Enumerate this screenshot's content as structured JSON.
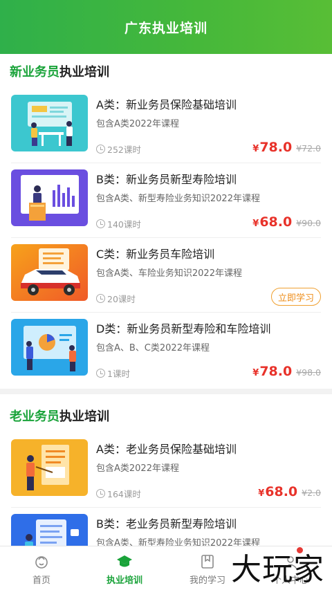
{
  "header": {
    "title": "广东执业培训"
  },
  "sections": [
    {
      "title_highlight": "新业务员",
      "title_rest": "执业培训",
      "courses": [
        {
          "title": "A类：新业务员保险基础培训",
          "desc": "包含A类2022年课程",
          "hours": "252课时",
          "price_symbol": "¥",
          "price": "78.0",
          "original": "¥72.0",
          "thumb": "meeting-illustration"
        },
        {
          "title": "B类：新业务员新型寿险培训",
          "desc": "包含A类、新型寿险业务知识2022年课程",
          "hours": "140课时",
          "price_symbol": "¥",
          "price": "68.0",
          "original": "¥90.0",
          "thumb": "presentation-illustration"
        },
        {
          "title": "C类：新业务员车险培训",
          "desc": "包含A类、车险业务知识2022年课程",
          "hours": "20课时",
          "button": "立即学习",
          "thumb": "car-illustration"
        },
        {
          "title": "D类：新业务员新型寿险和车险培训",
          "desc": "包含A、B、C类2022年课程",
          "hours": "1课时",
          "price_symbol": "¥",
          "price": "78.0",
          "original": "¥98.0",
          "thumb": "analytics-illustration"
        }
      ]
    },
    {
      "title_highlight": "老业务员",
      "title_rest": "执业培训",
      "courses": [
        {
          "title": "A类：老业务员保险基础培训",
          "desc": "包含A类2022年课程",
          "hours": "164课时",
          "price_symbol": "¥",
          "price": "68.0",
          "original": "¥2.0",
          "thumb": "teacher-illustration"
        },
        {
          "title": "B类：老业务员新型寿险培训",
          "desc": "包含A类、新型寿险业务知识2022年课程",
          "thumb": "document-illustration"
        }
      ]
    }
  ],
  "tabbar": {
    "items": [
      {
        "label": "首页",
        "icon": "home-icon"
      },
      {
        "label": "执业培训",
        "icon": "graduation-cap-icon",
        "active": true
      },
      {
        "label": "我的学习",
        "icon": "bookmark-book-icon"
      },
      {
        "label": "个人中心",
        "icon": "person-icon"
      }
    ]
  },
  "watermark": "大玩家",
  "colors": {
    "brand_green": "#1aa33a",
    "price_red": "#e8322a",
    "button_orange": "#ee8c17"
  }
}
